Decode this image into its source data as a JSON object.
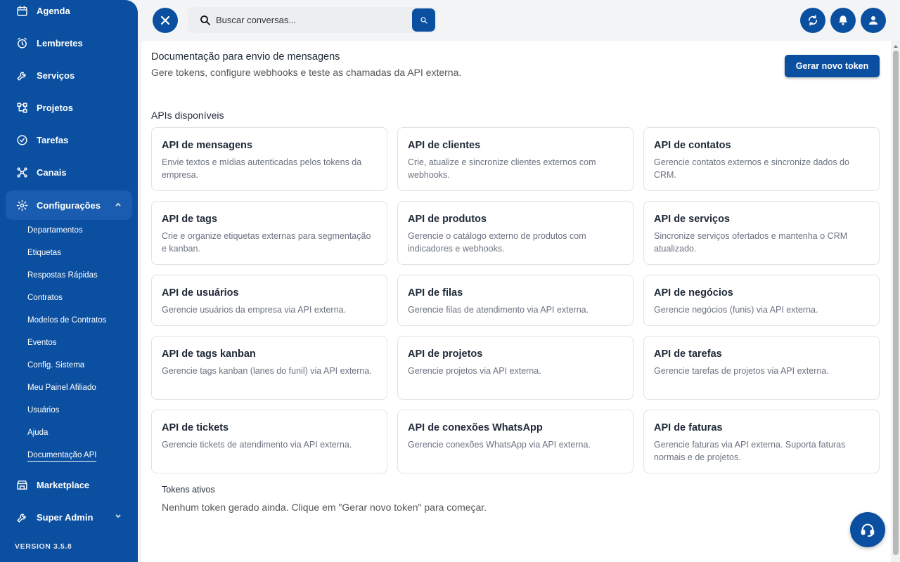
{
  "sidebar": {
    "items": [
      {
        "label": "Agenda",
        "icon": "calendar-icon"
      },
      {
        "label": "Lembretes",
        "icon": "alarm-clock-icon"
      },
      {
        "label": "Serviços",
        "icon": "wrench-icon"
      },
      {
        "label": "Projetos",
        "icon": "project-icon"
      },
      {
        "label": "Tarefas",
        "icon": "check-circle-icon"
      },
      {
        "label": "Canais",
        "icon": "network-icon"
      },
      {
        "label": "Configurações",
        "icon": "gear-icon"
      },
      {
        "label": "Marketplace",
        "icon": "store-icon"
      },
      {
        "label": "Super Admin",
        "icon": "wrench-icon"
      }
    ],
    "subitems": [
      "Departamentos",
      "Etiquetas",
      "Respostas Rápidas",
      "Contratos",
      "Modelos de Contratos",
      "Eventos",
      "Config. Sistema",
      "Meu Painel Afiliado",
      "Usuários",
      "Ajuda",
      "Documentação API"
    ],
    "version": "VERSION 3.5.8"
  },
  "topbar": {
    "search_placeholder": "Buscar conversas..."
  },
  "main": {
    "title": "Documentação para envio de mensagens",
    "subtitle": "Gere tokens, configure webhooks e teste as chamadas da API externa.",
    "generate_button": "Gerar novo token",
    "apis_title": "APIs disponíveis",
    "cards": [
      {
        "title": "API de mensagens",
        "desc": "Envie textos e mídias autenticadas pelos tokens da empresa."
      },
      {
        "title": "API de clientes",
        "desc": "Crie, atualize e sincronize clientes externos com webhooks."
      },
      {
        "title": "API de contatos",
        "desc": "Gerencie contatos externos e sincronize dados do CRM."
      },
      {
        "title": "API de tags",
        "desc": "Crie e organize etiquetas externas para segmentação e kanban."
      },
      {
        "title": "API de produtos",
        "desc": "Gerencie o catálogo externo de produtos com indicadores e webhooks."
      },
      {
        "title": "API de serviços",
        "desc": "Sincronize serviços ofertados e mantenha o CRM atualizado."
      },
      {
        "title": "API de usuários",
        "desc": "Gerencie usuários da empresa via API externa."
      },
      {
        "title": "API de filas",
        "desc": "Gerencie filas de atendimento via API externa."
      },
      {
        "title": "API de negócios",
        "desc": "Gerencie negócios (funis) via API externa."
      },
      {
        "title": "API de tags kanban",
        "desc": "Gerencie tags kanban (lanes do funil) via API externa."
      },
      {
        "title": "API de projetos",
        "desc": "Gerencie projetos via API externa."
      },
      {
        "title": "API de tarefas",
        "desc": "Gerencie tarefas de projetos via API externa."
      },
      {
        "title": "API de tickets",
        "desc": "Gerencie tickets de atendimento via API externa."
      },
      {
        "title": "API de conexões WhatsApp",
        "desc": "Gerencie conexões WhatsApp via API externa."
      },
      {
        "title": "API de faturas",
        "desc": "Gerencie faturas via API externa. Suporta faturas normais e de projetos."
      }
    ],
    "tokens_title": "Tokens ativos",
    "tokens_empty": "Nenhum token gerado ainda. Clique em \"Gerar novo token\" para começar."
  },
  "colors": {
    "primary": "#0b4fa0",
    "sidebar_active": "#1a5db0"
  }
}
